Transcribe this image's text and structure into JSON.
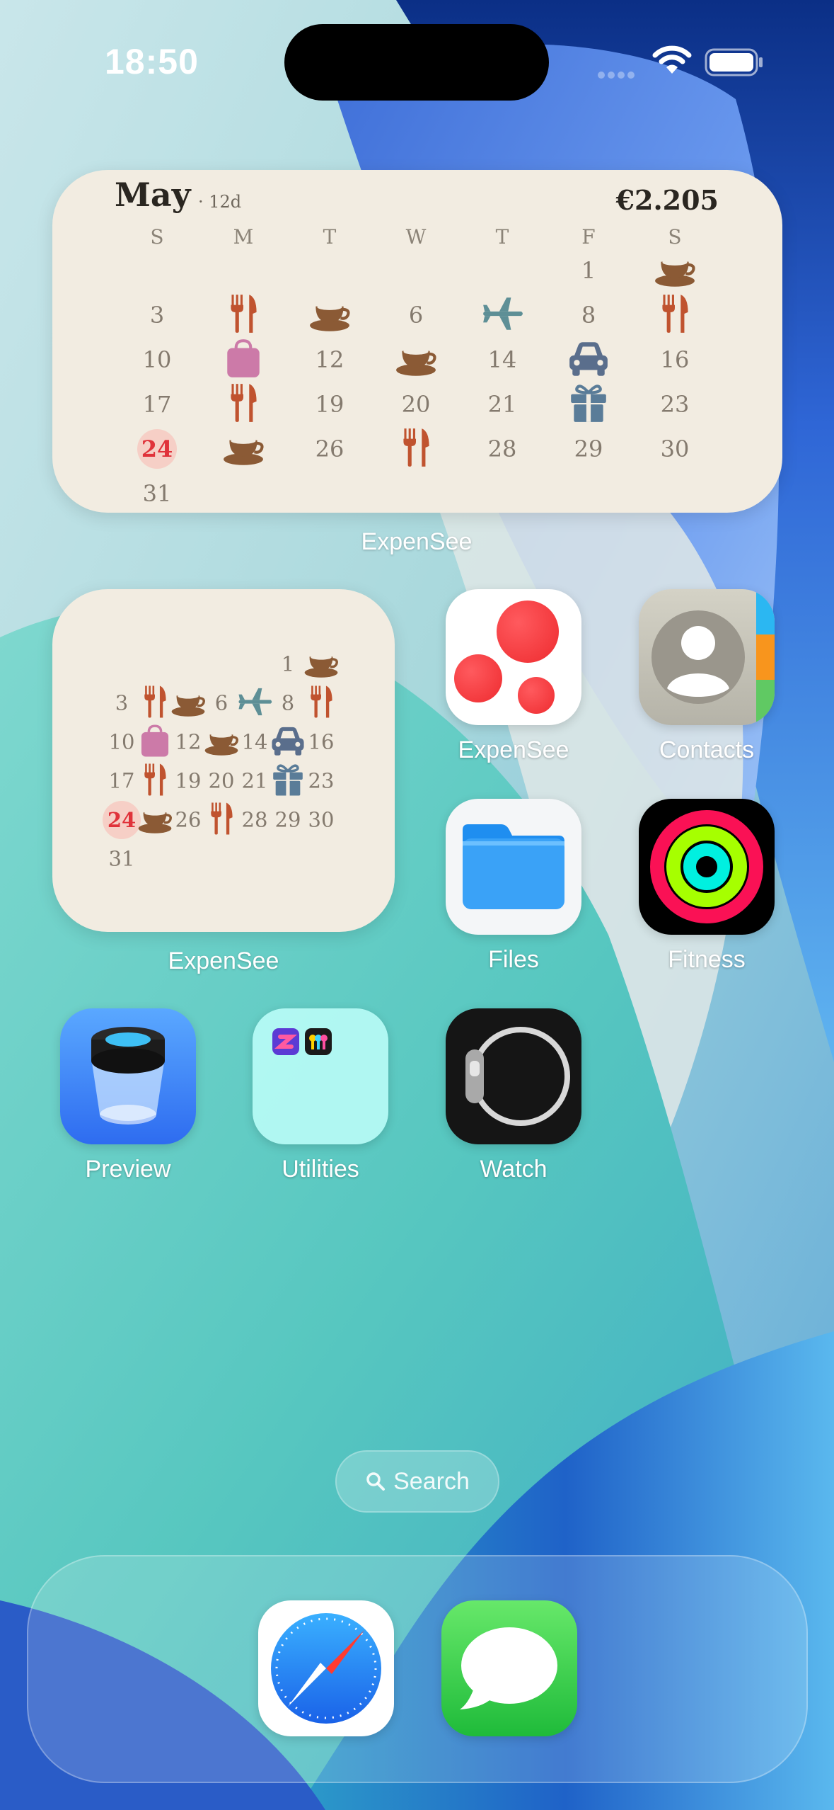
{
  "status_bar": {
    "time": "18:50"
  },
  "widget_large": {
    "month": "May",
    "days_tag": "· 12d",
    "total": "€2.205",
    "weekdays": [
      "S",
      "M",
      "T",
      "W",
      "T",
      "F",
      "S"
    ],
    "app_label": "ExpenSee",
    "days": [
      {
        "row": 0,
        "col": 5,
        "t": "1"
      },
      {
        "row": 0,
        "col": 6,
        "icon": "coffee-icon"
      },
      {
        "row": 1,
        "col": 0,
        "t": "3"
      },
      {
        "row": 1,
        "col": 1,
        "icon": "fork-knife-icon"
      },
      {
        "row": 1,
        "col": 2,
        "icon": "coffee-icon"
      },
      {
        "row": 1,
        "col": 3,
        "t": "6"
      },
      {
        "row": 1,
        "col": 4,
        "icon": "airplane-icon"
      },
      {
        "row": 1,
        "col": 5,
        "t": "8"
      },
      {
        "row": 1,
        "col": 6,
        "icon": "fork-knife-icon"
      },
      {
        "row": 2,
        "col": 0,
        "t": "10"
      },
      {
        "row": 2,
        "col": 1,
        "icon": "bag-icon"
      },
      {
        "row": 2,
        "col": 2,
        "t": "12"
      },
      {
        "row": 2,
        "col": 3,
        "icon": "coffee-icon"
      },
      {
        "row": 2,
        "col": 4,
        "t": "14"
      },
      {
        "row": 2,
        "col": 5,
        "icon": "car-icon"
      },
      {
        "row": 2,
        "col": 6,
        "t": "16"
      },
      {
        "row": 3,
        "col": 0,
        "t": "17"
      },
      {
        "row": 3,
        "col": 1,
        "icon": "fork-knife-icon"
      },
      {
        "row": 3,
        "col": 2,
        "t": "19"
      },
      {
        "row": 3,
        "col": 3,
        "t": "20"
      },
      {
        "row": 3,
        "col": 4,
        "t": "21"
      },
      {
        "row": 3,
        "col": 5,
        "icon": "gift-icon"
      },
      {
        "row": 3,
        "col": 6,
        "t": "23"
      },
      {
        "row": 4,
        "col": 0,
        "t": "24",
        "today": true
      },
      {
        "row": 4,
        "col": 1,
        "icon": "coffee-icon"
      },
      {
        "row": 4,
        "col": 2,
        "t": "26"
      },
      {
        "row": 4,
        "col": 3,
        "icon": "fork-knife-icon"
      },
      {
        "row": 4,
        "col": 4,
        "t": "28"
      },
      {
        "row": 4,
        "col": 5,
        "t": "29"
      },
      {
        "row": 4,
        "col": 6,
        "t": "30"
      },
      {
        "row": 5,
        "col": 0,
        "t": "31"
      }
    ]
  },
  "widget_small": {
    "app_label": "ExpenSee"
  },
  "apps": {
    "expensee": "ExpenSee",
    "contacts": "Contacts",
    "files": "Files",
    "fitness": "Fitness",
    "preview": "Preview",
    "utilities": "Utilities",
    "watch": "Watch"
  },
  "search": {
    "label": "Search"
  },
  "dock": {
    "apps": [
      "Safari",
      "Messages"
    ]
  }
}
